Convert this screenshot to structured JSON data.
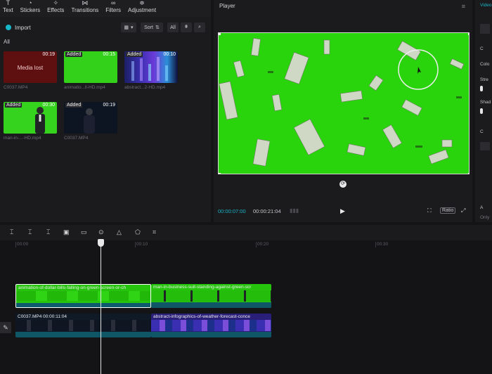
{
  "toolbar": {
    "items": [
      {
        "label": "Text",
        "icon": "text-icon"
      },
      {
        "label": "Stickers",
        "icon": "sticker-icon"
      },
      {
        "label": "Effects",
        "icon": "effects-icon"
      },
      {
        "label": "Transitions",
        "icon": "transitions-icon"
      },
      {
        "label": "Filters",
        "icon": "filters-icon"
      },
      {
        "label": "Adjustment",
        "icon": "adjustment-icon"
      }
    ]
  },
  "media": {
    "import_label": "Import",
    "sort_label": "Sort",
    "all_filter": "All",
    "all_label": "All",
    "clips": [
      {
        "badge": "",
        "duration": "00:19",
        "center_text": "Media lost",
        "name": "C0037.MP4"
      },
      {
        "badge": "Added",
        "duration": "00:15",
        "center_text": "",
        "name": "animatio...ll-HD.mp4"
      },
      {
        "badge": "Added",
        "duration": "00:10",
        "center_text": "",
        "name": "abstract...2-HD.mp4"
      },
      {
        "badge": "Added",
        "duration": "00:30",
        "center_text": "",
        "name": "man-in-...-HD.mp4"
      },
      {
        "badge": "Added",
        "duration": "00:19",
        "center_text": "",
        "name": "C0037.MP4"
      }
    ]
  },
  "player": {
    "title": "Player",
    "time_current": "00:00:07:00",
    "time_total": "00:00:21:04",
    "ratio_label": "Ratio"
  },
  "right_panel": {
    "title": "Video",
    "labels": [
      "C",
      "Colo",
      "Stre",
      "Shad",
      "C",
      "A",
      "Only"
    ]
  },
  "timeline": {
    "ticks": [
      "00:00",
      "00:10",
      "00:20",
      "00:30"
    ],
    "tracks": [
      {
        "label": "animation-of-dollar-bills-falling-on-green-screen-or-ch"
      },
      {
        "label": "man-in-business-suit-standing-against-green-scr"
      },
      {
        "label": "C0037.MP4   00:00:11:04"
      },
      {
        "label": "abstract-infographics-of-weather-forecast-conce"
      }
    ]
  }
}
